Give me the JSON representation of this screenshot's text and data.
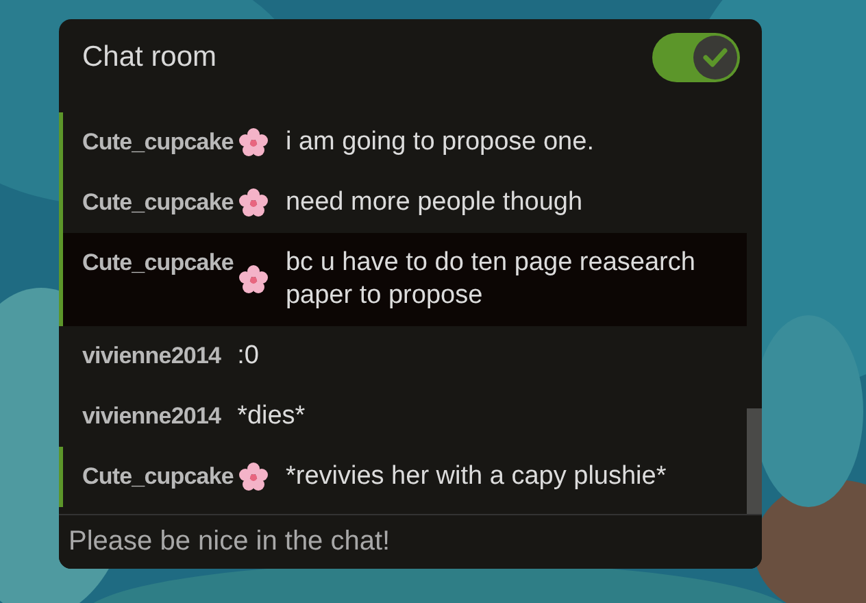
{
  "panel": {
    "title": "Chat room",
    "toggle": {
      "on": true
    }
  },
  "messages": [
    {
      "user": "Cute_cupcake",
      "kind": "flower",
      "highlighted": true,
      "hovered": false,
      "text": "i am going to propose one."
    },
    {
      "user": "Cute_cupcake",
      "kind": "flower",
      "highlighted": true,
      "hovered": false,
      "text": "need more people though"
    },
    {
      "user": "Cute_cupcake",
      "kind": "flower",
      "highlighted": true,
      "hovered": true,
      "text": "bc u have to do ten page reasearch paper to propose"
    },
    {
      "user": "vivienne2014",
      "kind": "plain",
      "highlighted": false,
      "hovered": false,
      "text": ":0"
    },
    {
      "user": "vivienne2014",
      "kind": "plain",
      "highlighted": false,
      "hovered": false,
      "text": "*dies*"
    },
    {
      "user": "Cute_cupcake",
      "kind": "flower",
      "highlighted": true,
      "hovered": false,
      "text": "*revivies her with a capy plushie*"
    }
  ],
  "input": {
    "placeholder": "Please be nice in the chat!"
  }
}
